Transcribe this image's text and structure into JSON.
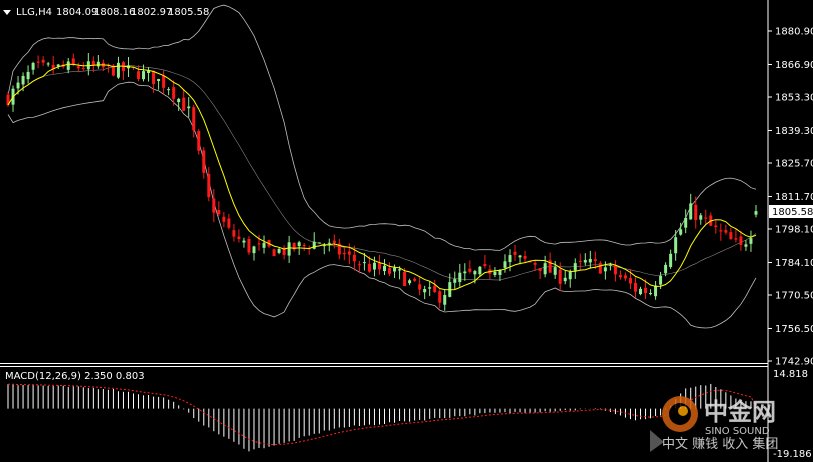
{
  "header": {
    "symbol": "LLG,H4",
    "open": "1804.09",
    "high": "1808.16",
    "low": "1802.97",
    "close": "1805.58"
  },
  "macd_label": "MACD(12,26,9) 2.350 0.803",
  "colors": {
    "background": "#000000",
    "bull": "#90ee90",
    "bear": "#ff1a1a",
    "ma": "#ffff00",
    "bands": "#c0c0c0",
    "macd_signal": "#ff2020",
    "macd_hist": "#ffffff",
    "axis": "#ffffff"
  },
  "watermark": {
    "brand": "中金网",
    "brand_en": "SINO SOUND",
    "slogan": "中文 赚钱 收入 集团"
  },
  "chart_data": {
    "type": "candlestick",
    "timeframe": "H4",
    "ylim": [
      1735,
      1893
    ],
    "price_ticks": [
      "1880.90",
      "1866.90",
      "1853.30",
      "1839.30",
      "1825.70",
      "1811.70",
      "1798.10",
      "1784.10",
      "1770.50",
      "1756.50",
      "1742.90"
    ],
    "current_price": "1805.58",
    "macd": {
      "params": "12,26,9",
      "macd_value": 2.35,
      "signal_value": 0.803,
      "ticks": [
        "14.818",
        "0.00",
        "-19.186"
      ],
      "ylim": [
        -19.186,
        14.818
      ]
    },
    "anchors": {
      "candles": 150,
      "close_path": [
        [
          0,
          1853
        ],
        [
          5,
          1865
        ],
        [
          15,
          1866
        ],
        [
          25,
          1864
        ],
        [
          28,
          1862
        ],
        [
          32,
          1858
        ],
        [
          36,
          1847
        ],
        [
          40,
          1810
        ],
        [
          44,
          1797
        ],
        [
          48,
          1790
        ],
        [
          55,
          1789
        ],
        [
          62,
          1793
        ],
        [
          68,
          1786
        ],
        [
          72,
          1782
        ],
        [
          78,
          1779
        ],
        [
          82,
          1772
        ],
        [
          86,
          1770
        ],
        [
          90,
          1778
        ],
        [
          95,
          1780
        ],
        [
          100,
          1786
        ],
        [
          105,
          1784
        ],
        [
          110,
          1778
        ],
        [
          115,
          1784
        ],
        [
          120,
          1781
        ],
        [
          125,
          1773
        ],
        [
          128,
          1772
        ],
        [
          132,
          1790
        ],
        [
          136,
          1806
        ],
        [
          140,
          1799
        ],
        [
          144,
          1793
        ],
        [
          146,
          1790
        ],
        [
          148,
          1797
        ],
        [
          149,
          1805.6
        ]
      ],
      "macd_path": [
        [
          0,
          10
        ],
        [
          20,
          8
        ],
        [
          32,
          4
        ],
        [
          40,
          -8
        ],
        [
          48,
          -17
        ],
        [
          55,
          -14
        ],
        [
          65,
          -8
        ],
        [
          80,
          -5
        ],
        [
          95,
          -2
        ],
        [
          108,
          -1
        ],
        [
          118,
          0
        ],
        [
          125,
          -5
        ],
        [
          130,
          -3
        ],
        [
          135,
          8
        ],
        [
          140,
          10
        ],
        [
          145,
          4
        ],
        [
          149,
          2.35
        ]
      ]
    }
  }
}
